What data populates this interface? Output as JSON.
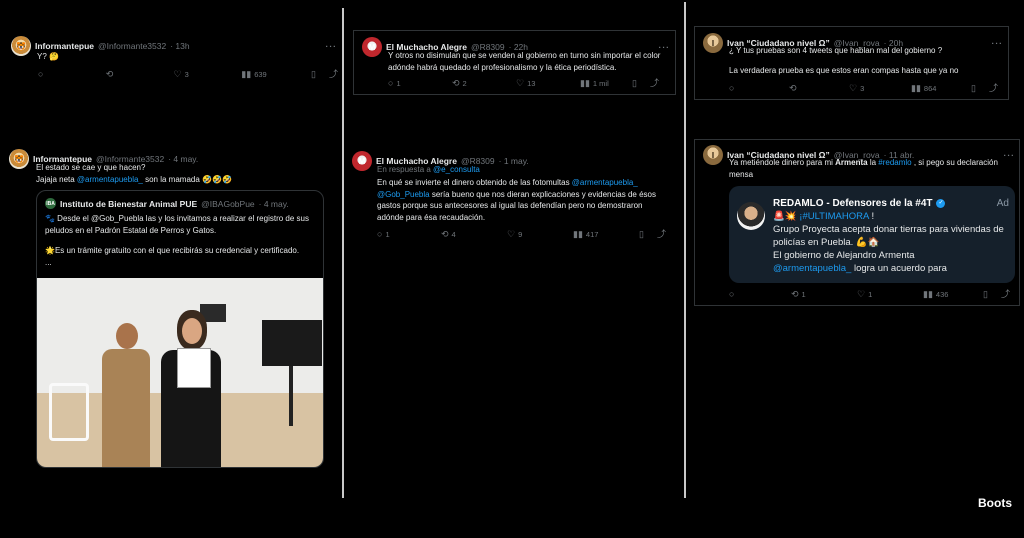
{
  "tweets": [
    {
      "author": "Informantepue",
      "handle": "@Informante3532",
      "time": "· 13h",
      "text": "Y? 🤔",
      "stats": {
        "reply": "",
        "retweet": "",
        "like": "3",
        "views": "639"
      }
    },
    {
      "author": "Informantepue",
      "handle": "@Informante3532",
      "time": "· 4 may.",
      "line1": "El estado se cae y que hacen?",
      "line2_prefix": "Jajaja neta ",
      "line2_mention": "@armentapuebla_",
      "line2_suffix": " son la mamada 🤣🤣🤣",
      "quote": {
        "author": "Instituto de Bienestar Animal PUE",
        "handle": "@IBAGobPue",
        "time": "· 4 may.",
        "para1": "🐾 Desde el @Gob_Puebla las y los invitamos a realizar el registro de sus peludos en el Padrón Estatal de Perros y Gatos.",
        "para2": "🌟Es un trámite gratuito con el que recibirás su credencial y certificado.",
        "more": "..."
      }
    },
    {
      "author": "El Muchacho Alegre",
      "handle": "@R8309",
      "time": "· 22h",
      "text": "Y otros no disimulan que se venden al gobierno en turno sin importar el color adónde habrá quedado el profesionalismo y la ética periodística.",
      "stats": {
        "reply": "1",
        "retweet": "2",
        "like": "13",
        "views": "1 mil"
      }
    },
    {
      "author": "El Muchacho Alegre",
      "handle": "@R8309",
      "time": "· 1 may.",
      "reply_prefix": "En respuesta a ",
      "reply_to": "@e_consulta",
      "text_prefix": "En qué se invierte el dinero obtenido de las fotomultas ",
      "mention1": "@armentapuebla_",
      "mention2": "@Gob_Puebla",
      "text_rest": " sería bueno que nos dieran explicaciones y evidencias de ésos gastos porque sus antecesores al igual las defendían pero no demostraron adónde para ésa recaudación.",
      "stats": {
        "reply": "1",
        "retweet": "4",
        "like": "9",
        "views": "417"
      }
    },
    {
      "author": "Ivan “Ciudadano nivel Ω”",
      "handle": "@Ivan_rova",
      "time": "· 20h",
      "line1": "¿ Y tus pruebas son 4 tweets que hablan mal del gobierno ?",
      "line2": "La verdadera prueba es que estos eran compas hasta que ya no",
      "stats": {
        "reply": "",
        "retweet": "",
        "like": "3",
        "views": "864"
      }
    },
    {
      "author": "Ivan “Ciudadano nivel Ω”",
      "handle": "@Ivan_rova",
      "time": "· 11 abr.",
      "text_prefix": "Ya metiéndole dinero para mi ",
      "bold": "Armenta",
      "mid": " la ",
      "hashtag": "#redamlo",
      "text_suffix": " , si pego su declaración mensa",
      "ad": {
        "title": "REDAMLO - Defensores de la #4T",
        "ad_label": "Ad",
        "line1_emoji": "🚨💥 ",
        "line1_tag": "¡#ULTIMAHORA",
        "line1_end": " !",
        "line2": "Grupo Proyecta acepta donar tierras para viviendas de policías en Puebla. 💪🏠",
        "line3": "El gobierno de Alejandro Armenta",
        "line4_mention": "@armentapuebla_",
        "line4_rest": " logra un acuerdo para"
      },
      "stats": {
        "reply": "",
        "retweet": "1",
        "like": "1",
        "views": "436"
      }
    }
  ],
  "icons": {
    "reply": "💬",
    "retweet": "⟲",
    "like": "♡",
    "views": "📊",
    "bookmark": "🔖",
    "share": "⤴",
    "more": "···"
  },
  "watermark": "Boots",
  "colors": {
    "link": "#1d9bf0",
    "muted": "#71767b",
    "ad_bg": "#15202b"
  }
}
